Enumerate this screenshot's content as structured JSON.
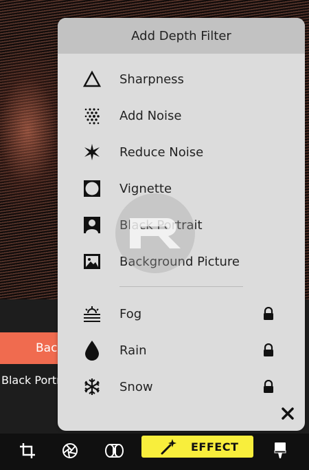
{
  "background": {
    "orange_button_label": "Back",
    "caption": "Black Portrait"
  },
  "panel": {
    "title": "Add Depth Filter",
    "items": [
      {
        "label": "Sharpness",
        "icon": "triangle-icon",
        "locked": false
      },
      {
        "label": "Add Noise",
        "icon": "noise-dots-icon",
        "locked": false
      },
      {
        "label": "Reduce Noise",
        "icon": "sparkle-icon",
        "locked": false
      },
      {
        "label": "Vignette",
        "icon": "vignette-icon",
        "locked": false
      },
      {
        "label": "Black Portrait",
        "icon": "portrait-icon",
        "locked": false
      },
      {
        "label": "Background Picture",
        "icon": "picture-icon",
        "locked": false
      },
      {
        "label": "Fog",
        "icon": "fog-icon",
        "locked": true
      },
      {
        "label": "Rain",
        "icon": "raindrop-icon",
        "locked": true
      },
      {
        "label": "Snow",
        "icon": "snowflake-icon",
        "locked": true
      }
    ],
    "close_icon": "close-icon"
  },
  "toolbar": {
    "tools": [
      "crop-icon",
      "aperture-icon",
      "lens-icon",
      "effect",
      "brush-icon"
    ],
    "effect_label": "EFFECT",
    "effect_color": "#f8ee3c"
  },
  "colors": {
    "panel_bg": "#dcdcdc",
    "header_bg": "#c2c2c2",
    "accent_orange": "#f06b4f"
  }
}
